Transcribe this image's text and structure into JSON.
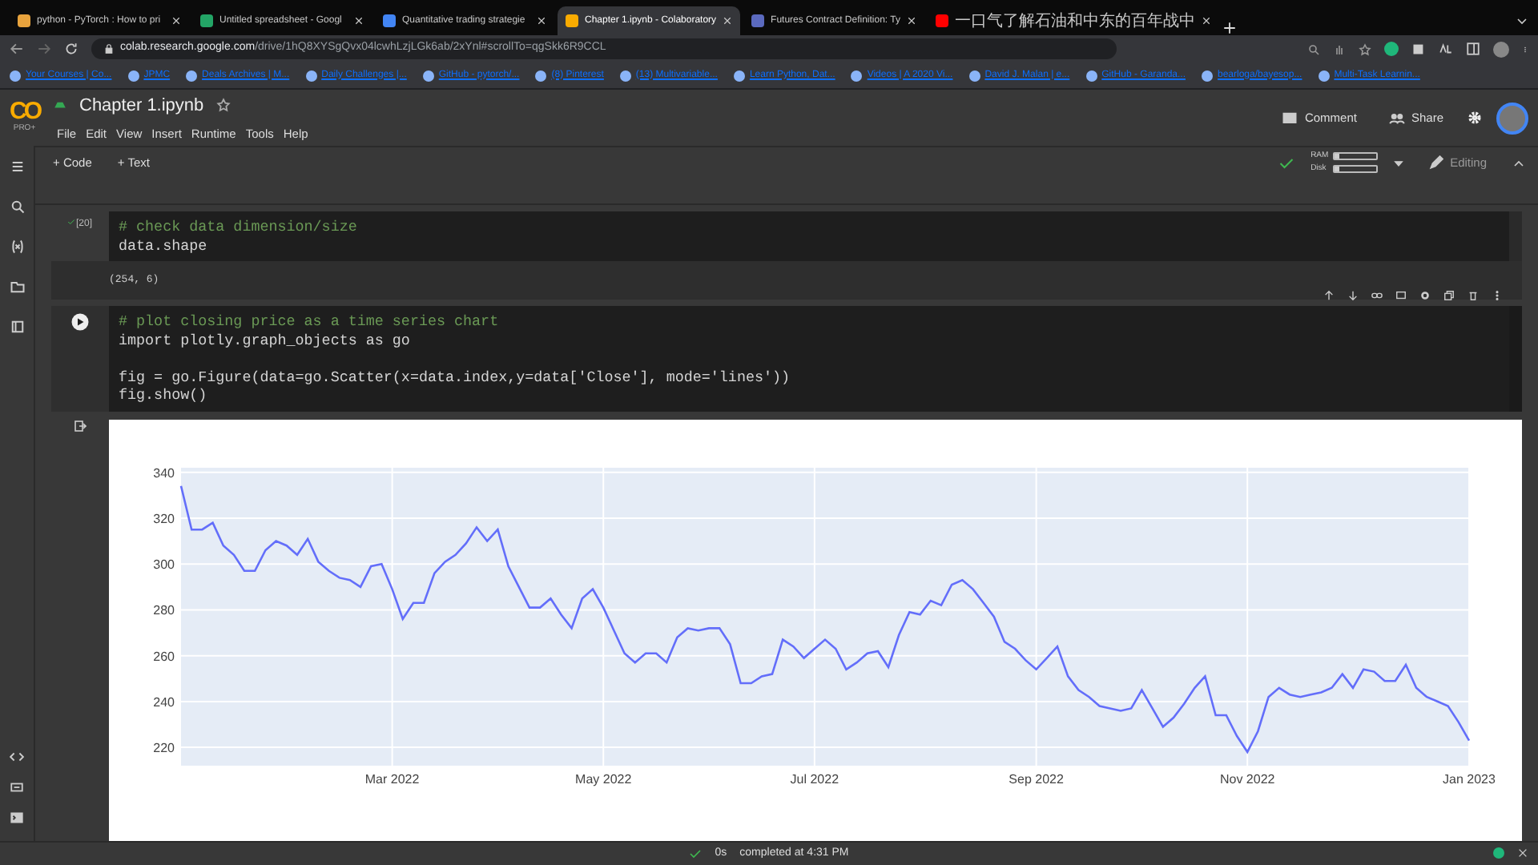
{
  "browser": {
    "tabs": [
      {
        "title": "python - PyTorch : How to pri",
        "selected": false,
        "color": "#e8a33d"
      },
      {
        "title": "Untitled spreadsheet - Googl",
        "selected": false,
        "color": "#23a566"
      },
      {
        "title": "Quantitative trading strategie",
        "selected": false,
        "color": "#4285f4"
      },
      {
        "title": "Chapter 1.ipynb - Colaboratory",
        "selected": true,
        "color": "#f9ab00"
      },
      {
        "title": "Futures Contract Definition: Ty",
        "selected": false,
        "color": "#5b6abf"
      },
      {
        "title": "一口气了解石油和中东的百年战中",
        "selected": false,
        "color": "#ff0000"
      }
    ],
    "address": {
      "host": "colab.research.google.com",
      "path": "/drive/1hQ8XYSgQvx04lcwhLzjLGk6ab/2xYnl#scrollTo=qgSkk6R9CCL"
    },
    "bookmarks": [
      "Your Courses | Co...",
      "JPMC",
      "Deals Archives | M...",
      "Daily Challenges |...",
      "GitHub - pytorch/...",
      "(8) Pinterest",
      "(13) Multivariable...",
      "Learn Python, Dat...",
      "Videos | A 2020 Vi...",
      "David J. Malan | e...",
      "GitHub - Garanda...",
      "bearloga/bayesop...",
      "Multi-Task Learnin..."
    ]
  },
  "notebook": {
    "logo": "CO",
    "plan": "PRO+",
    "title": "Chapter 1.ipynb",
    "menu": [
      "File",
      "Edit",
      "View",
      "Insert",
      "Runtime",
      "Tools",
      "Help"
    ],
    "comment": "Comment",
    "share": "Share",
    "add_buttons": [
      "+ Code",
      "+ Text"
    ],
    "resources": [
      {
        "label": "RAM",
        "level": 0.12
      },
      {
        "label": "Disk",
        "level": 0.1
      }
    ],
    "mode": "Editing"
  },
  "cells": [
    {
      "execution_count": "[20]",
      "lines": [
        {
          "kind": "comment",
          "text": "# check data dimension/size"
        },
        {
          "kind": "code",
          "text": "data.shape"
        }
      ],
      "output": "(254, 6)"
    },
    {
      "lines": [
        {
          "kind": "comment",
          "text": "# plot closing price as a time series chart"
        },
        {
          "kind": "code",
          "text": "import plotly.graph_objects as go"
        },
        {
          "kind": "blank"
        },
        {
          "kind": "code",
          "text": "fig = go.Figure(data=go.Scatter(x=data.index,y=data['Close'], mode='lines'))"
        },
        {
          "kind": "code",
          "text": "fig.show()"
        }
      ],
      "chart_data": {
        "type": "line",
        "grid": true,
        "ylim": [
          212,
          342
        ],
        "yticks": [
          220,
          240,
          260,
          280,
          300,
          320,
          340
        ],
        "categories": [
          null,
          null,
          null,
          null,
          null,
          null,
          null,
          null,
          null,
          null,
          null,
          null,
          null,
          null,
          null,
          null,
          null,
          null,
          null,
          null,
          "Mar 2022",
          null,
          null,
          null,
          null,
          null,
          null,
          null,
          null,
          null,
          null,
          null,
          null,
          null,
          null,
          null,
          null,
          null,
          null,
          null,
          "May 2022",
          null,
          null,
          null,
          null,
          null,
          null,
          null,
          null,
          null,
          null,
          null,
          null,
          null,
          null,
          null,
          null,
          null,
          null,
          null,
          "Jul 2022",
          null,
          null,
          null,
          null,
          null,
          null,
          null,
          null,
          null,
          null,
          null,
          null,
          null,
          null,
          null,
          null,
          null,
          null,
          null,
          null,
          "Sep 2022",
          null,
          null,
          null,
          null,
          null,
          null,
          null,
          null,
          null,
          null,
          null,
          null,
          null,
          null,
          null,
          null,
          null,
          null,
          null,
          "Nov 2022",
          null,
          null,
          null,
          null,
          null,
          null,
          null,
          null,
          null,
          null,
          null,
          null,
          null,
          null,
          null,
          null,
          null,
          null,
          null,
          null,
          "Jan 2023"
        ],
        "series": [
          {
            "color": "#636efa",
            "values": [
              334,
              315,
              315,
              318,
              308,
              304,
              297,
              297,
              306,
              310,
              308,
              304,
              311,
              301,
              297,
              294,
              293,
              290,
              299,
              300,
              289,
              276,
              283,
              283,
              296,
              301,
              304,
              309,
              316,
              310,
              315,
              299,
              290,
              281,
              281,
              285,
              278,
              272,
              285,
              289,
              281,
              271,
              261,
              257,
              261,
              261,
              257,
              268,
              272,
              271,
              272,
              272,
              265,
              248,
              248,
              251,
              252,
              267,
              264,
              259,
              263,
              267,
              263,
              254,
              257,
              261,
              262,
              255,
              269,
              279,
              278,
              284,
              282,
              291,
              293,
              289,
              283,
              277,
              266,
              263,
              258,
              254,
              259,
              264,
              251,
              245,
              242,
              238,
              237,
              236,
              237,
              245,
              237,
              229,
              233,
              239,
              246,
              251,
              234,
              234,
              225,
              218,
              227,
              242,
              246,
              243,
              242,
              243,
              244,
              246,
              252,
              246,
              254,
              253,
              249,
              249,
              256,
              246,
              242,
              240,
              238,
              231,
              223
            ]
          }
        ]
      }
    }
  ],
  "status_bar": {
    "duration": "0s",
    "message": "completed at 4:31 PM"
  }
}
